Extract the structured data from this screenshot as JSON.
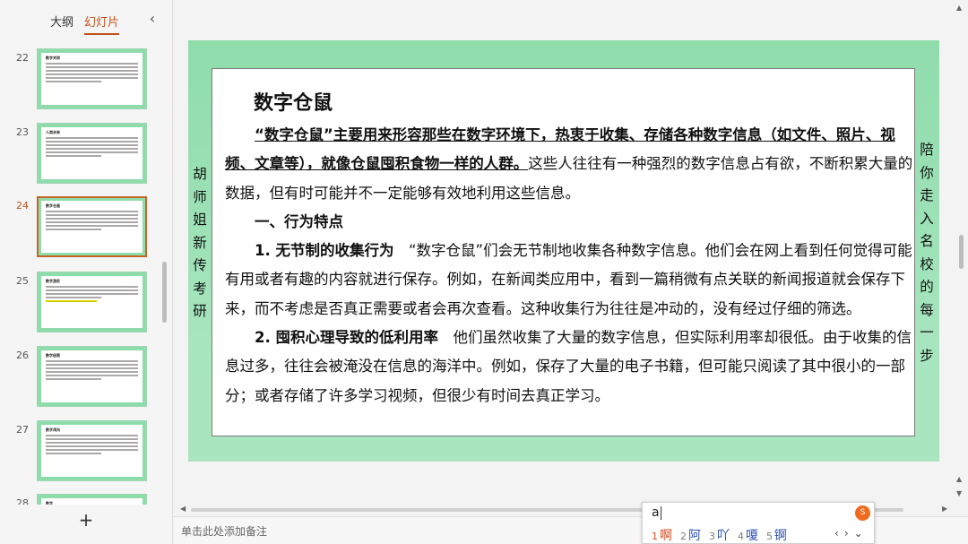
{
  "panel": {
    "tabs": [
      {
        "label": "大纲"
      },
      {
        "label": "幻灯片"
      }
    ],
    "add_label": "+"
  },
  "thumbnails": [
    {
      "number": "22",
      "title": "数字共同"
    },
    {
      "number": "23",
      "title": "人类未来"
    },
    {
      "number": "24",
      "title": "数字仓鼠"
    },
    {
      "number": "25",
      "title": "数字游民"
    },
    {
      "number": "26",
      "title": "数字极简"
    },
    {
      "number": "27",
      "title": "数字鸿沟"
    },
    {
      "number": "28",
      "title": "数字"
    }
  ],
  "slide": {
    "title": "数字仓鼠",
    "intro_bold": "“数字仓鼠”主要用来形容那些在数字环境下，热衷于收集、存储各种数字信息（如文件、照片、视频、文章等），就像仓鼠囤积食物一样的人群。",
    "intro_rest": "这些人往往有一种强烈的数字信息占有欲，不断积累大量的数据，但有时可能并不一定能够有效地利用这些信息。",
    "section_heading": "一、行为特点",
    "point1_heading": "1. 无节制的收集行为",
    "point1_text": "“数字仓鼠”们会无节制地收集各种数字信息。他们会在网上看到任何觉得可能有用或者有趣的内容就进行保存。例如，在新闻类应用中，看到一篇稍微有点关联的新闻报道就会保存下来，而不考虑是否真正需要或者会再次查看。这种收集行为往往是冲动的，没有经过仔细的筛选。",
    "point2_heading": "2. 囤积心理导致的低利用率",
    "point2_text": "他们虽然收集了大量的数字信息，但实际利用率却很低。由于收集的信息过多，往往会被淹没在信息的海洋中。例如，保存了大量的电子书籍，但可能只阅读了其中很小的一部分；或者存储了许多学习视频，但很少有时间去真正学习。",
    "left_vertical": "胡师姐新传考研",
    "right_vertical": "陪你走入名校的每一步"
  },
  "notes": {
    "placeholder": "单击此处添加备注"
  },
  "ime": {
    "input": "a",
    "candidates": [
      {
        "index": "1",
        "text": "啊"
      },
      {
        "index": "2",
        "text": "阿"
      },
      {
        "index": "3",
        "text": "吖"
      },
      {
        "index": "4",
        "text": "嗄"
      },
      {
        "index": "5",
        "text": "锕"
      }
    ],
    "nav": {
      "prev": "‹",
      "next": "›",
      "expand": "⌄"
    },
    "logo": "S"
  }
}
